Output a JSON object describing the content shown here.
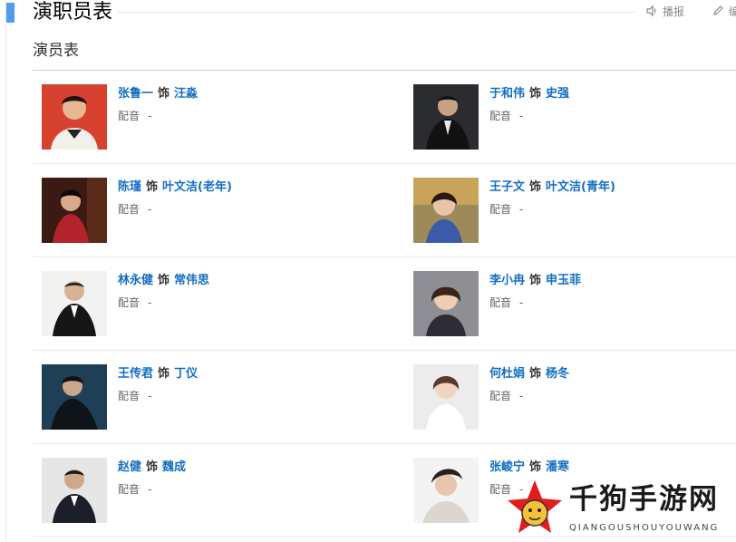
{
  "header": {
    "title": "演职员表",
    "report_label": "播报",
    "edit_label": "编",
    "report_icon": "speaker-icon",
    "edit_icon": "pencil-icon"
  },
  "section": {
    "title": "演员表"
  },
  "cast": [
    {
      "actor": "张鲁一",
      "as": "饰",
      "role": "汪淼",
      "dub_label": "配音",
      "dub_value": "-"
    },
    {
      "actor": "于和伟",
      "as": "饰",
      "role": "史强",
      "dub_label": "配音",
      "dub_value": "-"
    },
    {
      "actor": "陈瑾",
      "as": "饰",
      "role": "叶文洁(老年)",
      "dub_label": "配音",
      "dub_value": "-"
    },
    {
      "actor": "王子文",
      "as": "饰",
      "role": "叶文洁(青年)",
      "dub_label": "配音",
      "dub_value": "-"
    },
    {
      "actor": "林永健",
      "as": "饰",
      "role": "常伟思",
      "dub_label": "配音",
      "dub_value": "-"
    },
    {
      "actor": "李小冉",
      "as": "饰",
      "role": "申玉菲",
      "dub_label": "配音",
      "dub_value": "-"
    },
    {
      "actor": "王传君",
      "as": "饰",
      "role": "丁仪",
      "dub_label": "配音",
      "dub_value": "-"
    },
    {
      "actor": "何杜娟",
      "as": "饰",
      "role": "杨冬",
      "dub_label": "配音",
      "dub_value": "-"
    },
    {
      "actor": "赵健",
      "as": "饰",
      "role": "魏成",
      "dub_label": "配音",
      "dub_value": "-"
    },
    {
      "actor": "张峻宁",
      "as": "饰",
      "role": "潘寒",
      "dub_label": "配音",
      "dub_value": "-"
    }
  ],
  "watermark": {
    "text": "千狗手游网",
    "subtext": "QIANGOUSHOUYOUWANG",
    "logo": "dog-star-logo"
  },
  "colors": {
    "accent": "#4f9cee",
    "link": "#136ec2"
  }
}
